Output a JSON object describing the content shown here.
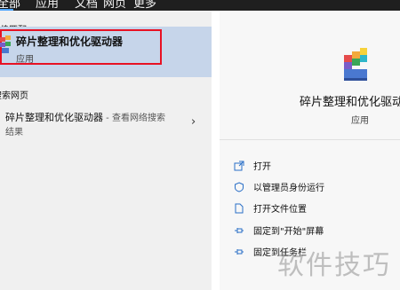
{
  "top_tabs": [
    {
      "label": "全部"
    },
    {
      "label": "应用"
    },
    {
      "label": "文档"
    },
    {
      "label": "网页"
    },
    {
      "label": "更多"
    }
  ],
  "left": {
    "best_match_title": "最佳匹配",
    "best_item": {
      "name": "碎片整理和优化驱动器",
      "type": "应用"
    },
    "web_title": "搜索网页",
    "web_item": {
      "name": "碎片整理和优化驱动器",
      "suffix": " - 查看网络搜索",
      "line2": "结果"
    }
  },
  "right": {
    "title": "碎片整理和优化驱动器",
    "subtitle": "应用",
    "actions": [
      {
        "label": "打开",
        "icon": "open-icon"
      },
      {
        "label": "以管理员身份运行",
        "icon": "shield-admin-icon"
      },
      {
        "label": "打开文件位置",
        "icon": "file-location-icon"
      },
      {
        "label": "固定到\"开始\"屏幕",
        "icon": "pin-icon"
      },
      {
        "label": "固定到任务栏",
        "icon": "pin-icon"
      }
    ]
  },
  "watermark": "软件技巧",
  "colors": {
    "selected_bg": "#c6d5ea",
    "highlight_border": "#e81123",
    "accent": "#4aa3ff",
    "topbar": "#1f1f1f"
  }
}
